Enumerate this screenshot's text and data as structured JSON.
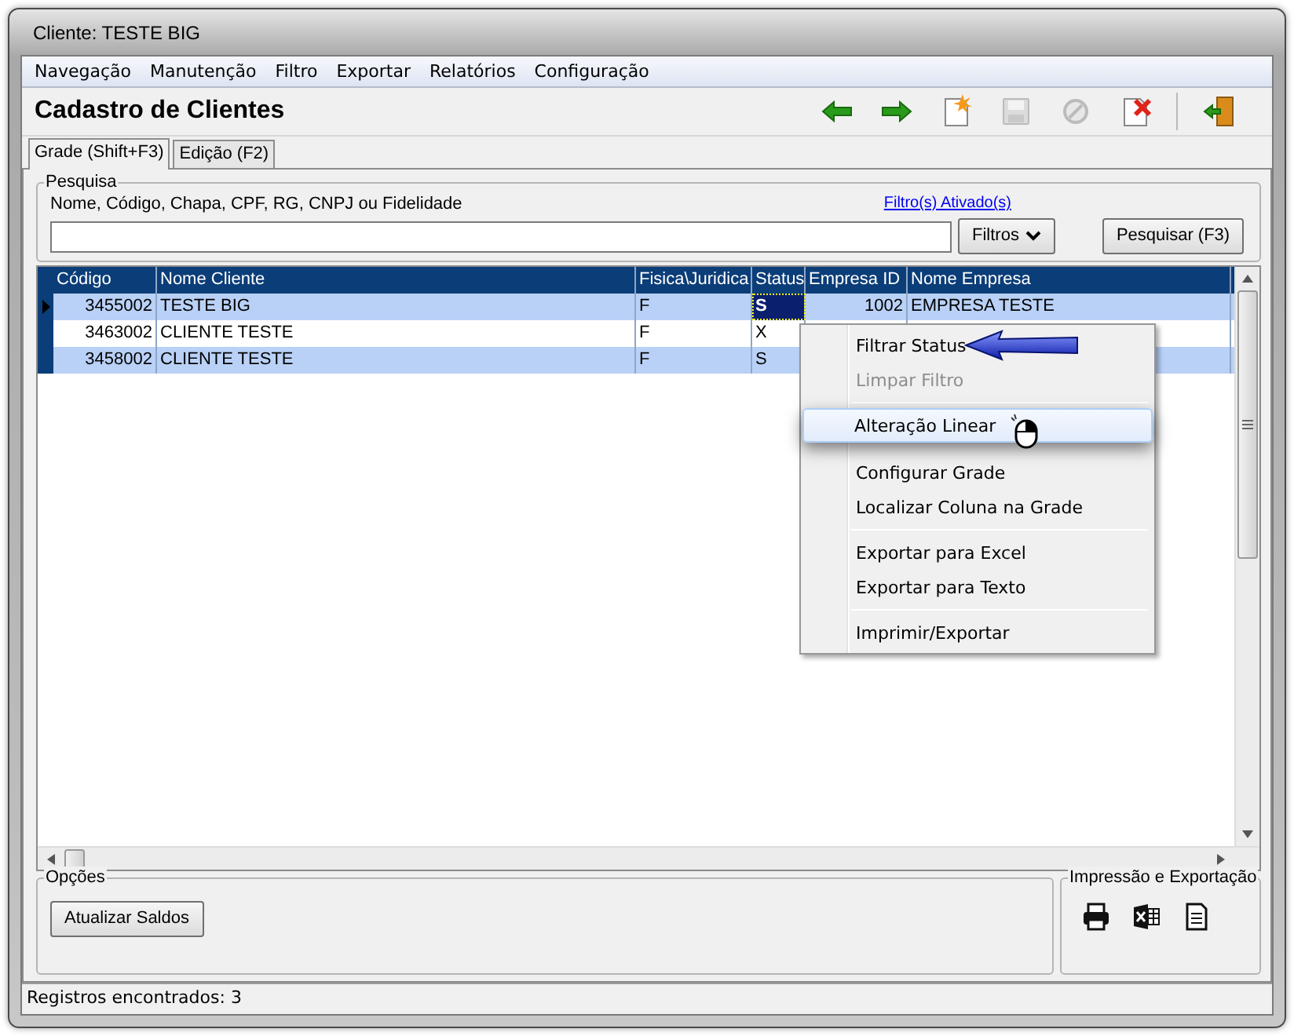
{
  "window": {
    "title": "Cliente: TESTE BIG"
  },
  "menu": [
    "Navegação",
    "Manutenção",
    "Filtro",
    "Exportar",
    "Relatórios",
    "Configuração"
  ],
  "header": {
    "title": "Cadastro de Clientes"
  },
  "toolbar": [
    {
      "kind": "back",
      "disabled": false
    },
    {
      "kind": "forward",
      "disabled": false
    },
    {
      "kind": "new",
      "disabled": false
    },
    {
      "kind": "save",
      "disabled": true
    },
    {
      "kind": "cancel",
      "disabled": true
    },
    {
      "kind": "delete",
      "disabled": false
    },
    {
      "kind": "exit",
      "disabled": false
    }
  ],
  "tabs": [
    {
      "label": "Grade (Shift+F3)",
      "selected": true
    },
    {
      "label": "Edição (F2)",
      "selected": false
    }
  ],
  "search": {
    "group": "Pesquisa",
    "label": "Nome, Código, Chapa, CPF, RG, CNPJ ou Fidelidade",
    "filter_link": "Filtro(s) Ativado(s)",
    "filters_button": "Filtros",
    "search_button": "Pesquisar (F3)"
  },
  "table": {
    "columns": [
      "Código",
      "Nome Cliente",
      "Fisica\\Juridica",
      "Status",
      "Empresa ID",
      "Nome Empresa"
    ],
    "rows": [
      {
        "selected": true,
        "shaded": true,
        "cells": [
          {
            "text": "3455002",
            "focused": false
          },
          {
            "text": "TESTE BIG",
            "focused": false
          },
          {
            "text": "F",
            "focused": false
          },
          {
            "text": "S",
            "focused": true
          },
          {
            "text": "1002",
            "focused": false
          },
          {
            "text": "EMPRESA TESTE",
            "focused": false
          }
        ]
      },
      {
        "selected": false,
        "shaded": false,
        "cells": [
          {
            "text": "3463002",
            "focused": false
          },
          {
            "text": "CLIENTE TESTE",
            "focused": false
          },
          {
            "text": "F",
            "focused": false
          },
          {
            "text": "X",
            "focused": false
          }
        ]
      },
      {
        "selected": false,
        "shaded": true,
        "cells": [
          {
            "text": "3458002",
            "focused": false
          },
          {
            "text": "CLIENTE TESTE",
            "focused": false
          },
          {
            "text": "F",
            "focused": false
          },
          {
            "text": "S",
            "focused": false
          }
        ]
      }
    ]
  },
  "context_menu": [
    {
      "kind": "item",
      "label": "Filtrar Status",
      "disabled": false,
      "selected": false
    },
    {
      "kind": "item",
      "label": "Limpar Filtro",
      "disabled": true,
      "selected": false
    },
    {
      "kind": "separator"
    },
    {
      "kind": "item",
      "label": "Alteração Linear",
      "disabled": false,
      "selected": true
    },
    {
      "kind": "gap"
    },
    {
      "kind": "item",
      "label": "Configurar Grade",
      "disabled": false,
      "selected": false
    },
    {
      "kind": "item",
      "label": "Localizar Coluna na Grade",
      "disabled": false,
      "selected": false
    },
    {
      "kind": "separator"
    },
    {
      "kind": "item",
      "label": "Exportar para Excel",
      "disabled": false,
      "selected": false
    },
    {
      "kind": "item",
      "label": "Exportar para Texto",
      "disabled": false,
      "selected": false
    },
    {
      "kind": "separator"
    },
    {
      "kind": "item",
      "label": "Imprimir/Exportar",
      "disabled": false,
      "selected": false
    }
  ],
  "options": {
    "group": "Opções",
    "buttons": [
      "Atualizar Saldos"
    ]
  },
  "export": {
    "group": "Impressão e Exportação",
    "icons": [
      {
        "kind": "print"
      },
      {
        "kind": "excel"
      },
      {
        "kind": "text"
      }
    ]
  },
  "status_bar": "Registros encontrados: 3"
}
